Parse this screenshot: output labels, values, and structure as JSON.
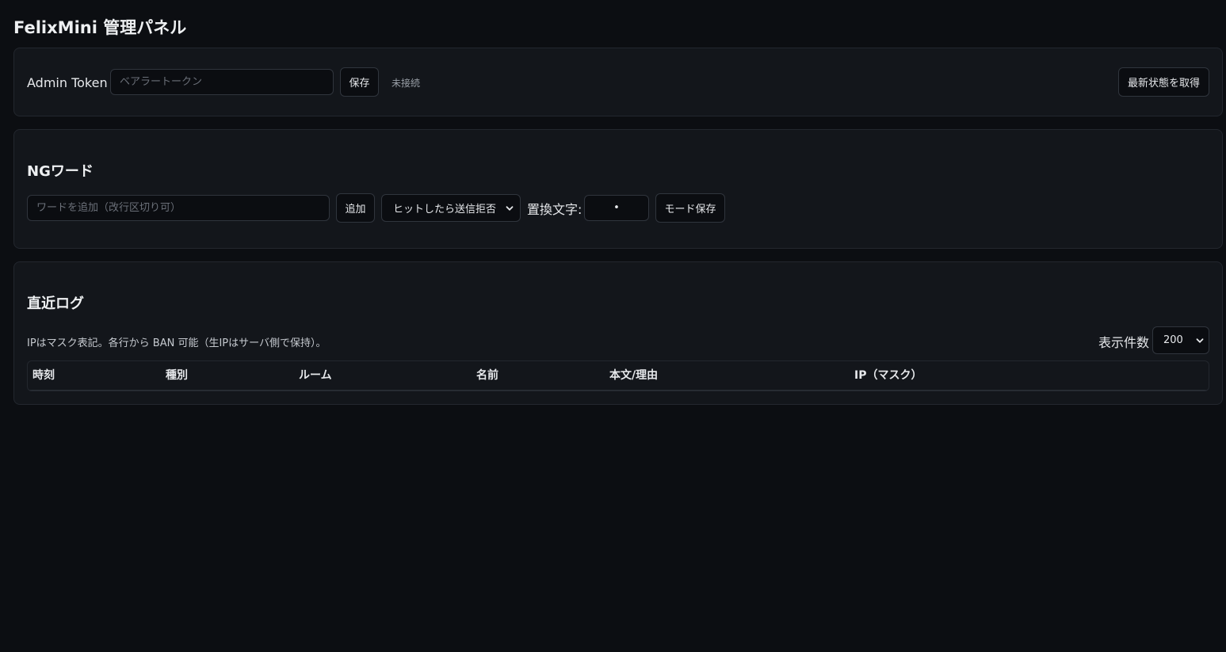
{
  "app": {
    "title": "FelixMini 管理パネル"
  },
  "token_bar": {
    "label": "Admin Token",
    "input_placeholder": "ベアラートークン",
    "input_value": "",
    "save_label": "保存",
    "status_text": "未接続",
    "refresh_label": "最新状態を取得"
  },
  "ng_words": {
    "heading": "NGワード",
    "word_input_placeholder": "ワードを追加（改行区切り可）",
    "word_input_value": "",
    "add_label": "追加",
    "mode_select_value": "ヒットしたら送信拒否",
    "replace_label": "置換文字:",
    "replace_value": "•",
    "mode_save_label": "モード保存"
  },
  "logs": {
    "heading": "直近ログ",
    "note": "IPはマスク表記。各行から BAN 可能（生IPはサーバ側で保持）。",
    "count_label": "表示件数",
    "count_value": "200",
    "columns": [
      "時刻",
      "種別",
      "ルーム",
      "名前",
      "本文/理由",
      "IP（マスク）"
    ],
    "rows": []
  },
  "icons": {
    "select_chevron": "chevron-down-icon"
  },
  "colors": {
    "background": "#0c0e12",
    "card": "#13161b",
    "border": "#30353d",
    "text": "#e6e8eb",
    "muted": "#9aa0a8"
  }
}
